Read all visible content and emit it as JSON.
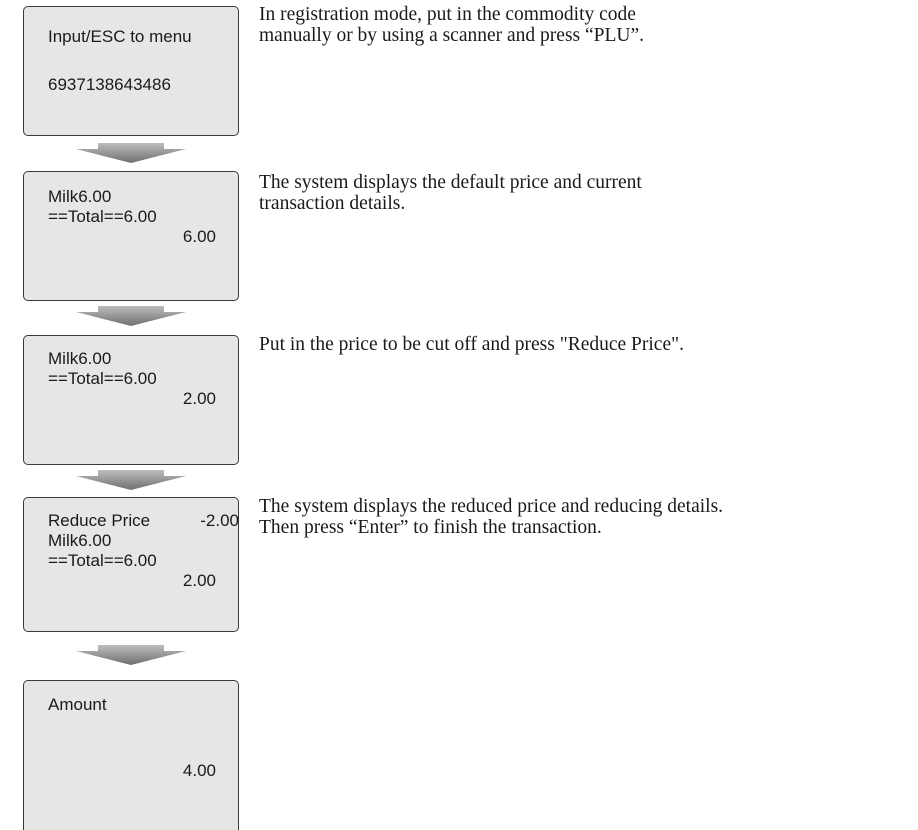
{
  "steps": [
    {
      "screen": {
        "line1": "Input/ESC to menu",
        "line2": "6937138643486"
      },
      "description": {
        "line1": "In registration mode, put in the commodity code",
        "line2": "manually or by using a scanner and press “PLU”."
      }
    },
    {
      "screen": {
        "line1": "Milk6.00",
        "line2": "==Total==6.00",
        "line3": "6.00"
      },
      "description": {
        "line1": "The system displays the default price and current",
        "line2": "transaction details."
      }
    },
    {
      "screen": {
        "line1": "Milk6.00",
        "line2": "==Total==6.00",
        "line3": "2.00"
      },
      "description": {
        "line1": "Put in the price to be cut off and press \"Reduce Price\"."
      }
    },
    {
      "screen": {
        "line1_label": "Reduce Price",
        "line1_value": "-2.00",
        "line2": "Milk6.00",
        "line3": "==Total==6.00",
        "line4": "2.00"
      },
      "description": {
        "line1": "The system displays the reduced price and reducing details.",
        "line2": "Then press “Enter” to finish the transaction."
      }
    },
    {
      "screen": {
        "line1": "Amount",
        "line2": "4.00"
      }
    }
  ]
}
